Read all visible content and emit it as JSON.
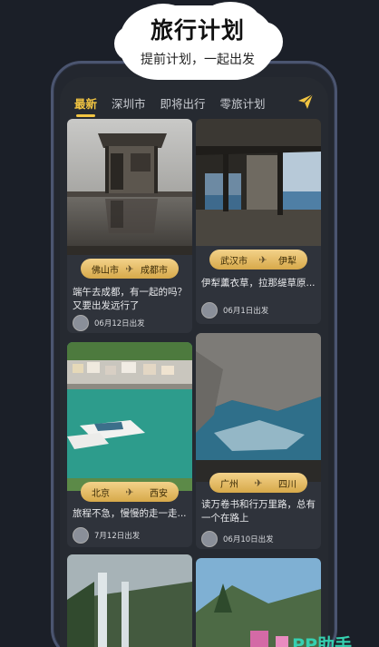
{
  "bubble": {
    "title": "旅行计划",
    "subtitle": "提前计划，一起出发"
  },
  "tabs": [
    "最新",
    "深圳市",
    "即将出行",
    "零旅计划"
  ],
  "active_tab": 0,
  "cards": [
    {
      "from": "佛山市",
      "to": "成都市",
      "desc": "端午去成都，有一起的吗？又要出发远行了",
      "date": "06月12日出发"
    },
    {
      "from": "武汉市",
      "to": "伊犁",
      "desc": "伊犁薰衣草，拉那缇草原...",
      "date": "06月1日出发"
    },
    {
      "from": "北京",
      "to": "西安",
      "desc": "旅程不急，慢慢的走一走...",
      "date": "7月12日出发"
    },
    {
      "from": "广州",
      "to": "四川",
      "desc": "读万卷书和行万里路，总有一个在路上",
      "date": "06月10日出发"
    }
  ],
  "watermark": "PP助手",
  "colors": {
    "accent": "#f2c542",
    "background": "#1b1f28"
  }
}
